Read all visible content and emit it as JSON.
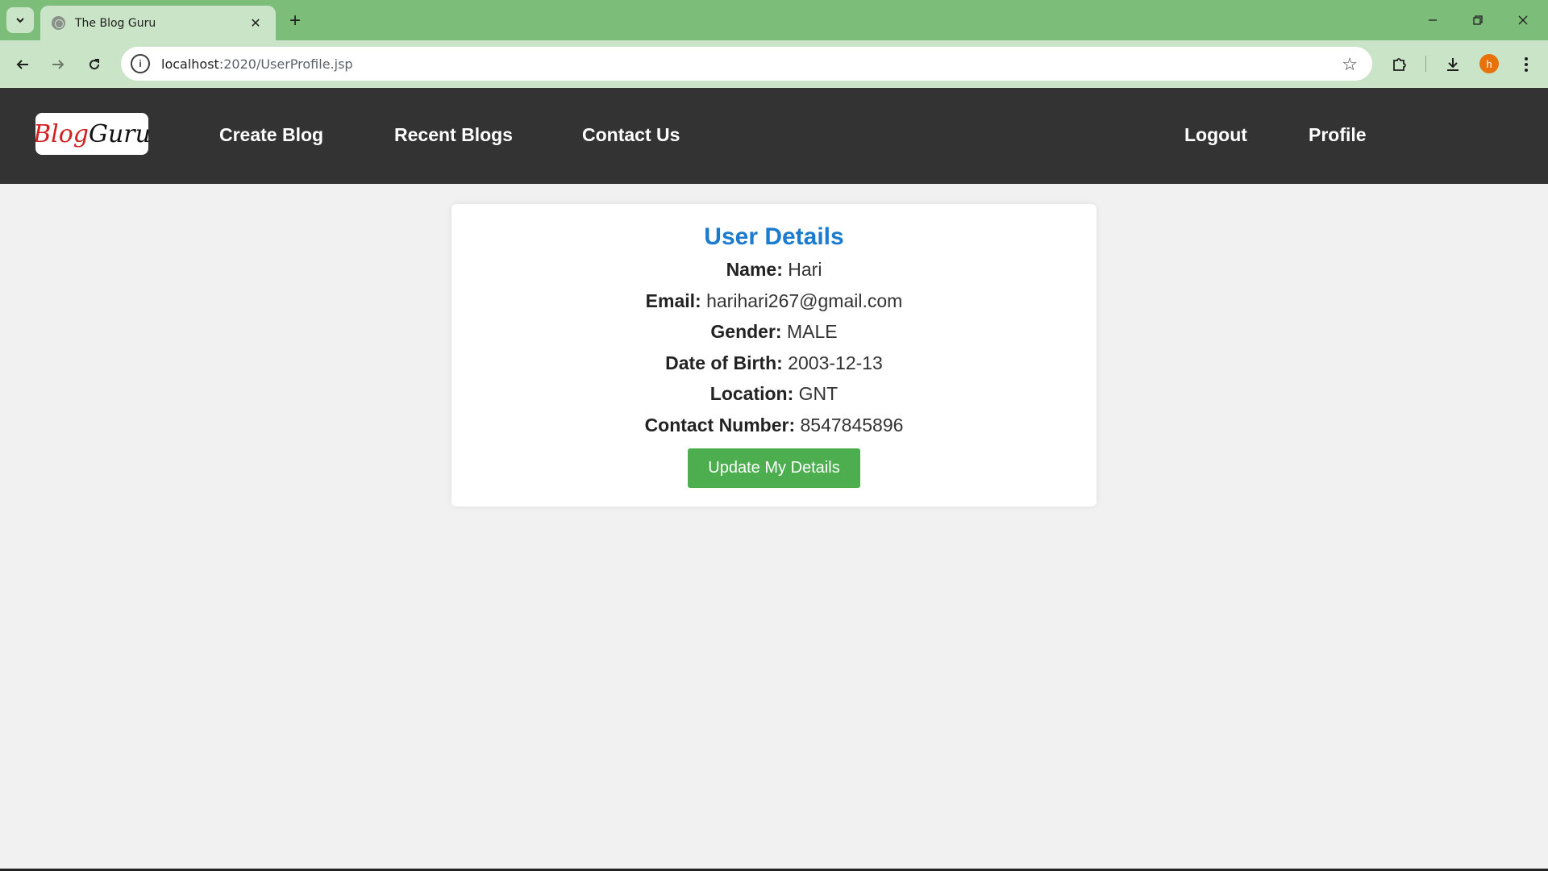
{
  "browser": {
    "tab_title": "The Blog Guru",
    "url_host": "localhost",
    "url_path": ":2020/UserProfile.jsp",
    "avatar_initial": "h",
    "avatar_color": "#e8710a",
    "theme_color": "#7dbd7a"
  },
  "site": {
    "logo": {
      "part1": "Blog",
      "part2": "Guru"
    },
    "nav": {
      "create_blog": "Create Blog",
      "recent_blogs": "Recent Blogs",
      "contact_us": "Contact Us",
      "logout": "Logout",
      "profile": "Profile"
    }
  },
  "profile": {
    "title": "User Details",
    "fields": [
      {
        "label": "Name:",
        "value": "Hari"
      },
      {
        "label": "Email:",
        "value": "harihari267@gmail.com"
      },
      {
        "label": "Gender:",
        "value": "MALE"
      },
      {
        "label": "Date of Birth:",
        "value": "2003-12-13"
      },
      {
        "label": "Location:",
        "value": "GNT"
      },
      {
        "label": "Contact Number:",
        "value": "8547845896"
      }
    ],
    "update_button": "Update My Details"
  },
  "icons": [
    "chevron-down-icon",
    "globe-icon",
    "close-icon",
    "plus-icon",
    "minimize-icon",
    "restore-icon",
    "back-arrow-icon",
    "forward-arrow-icon",
    "reload-icon",
    "info-icon",
    "star-icon",
    "extensions-icon",
    "download-icon",
    "menu-icon"
  ]
}
